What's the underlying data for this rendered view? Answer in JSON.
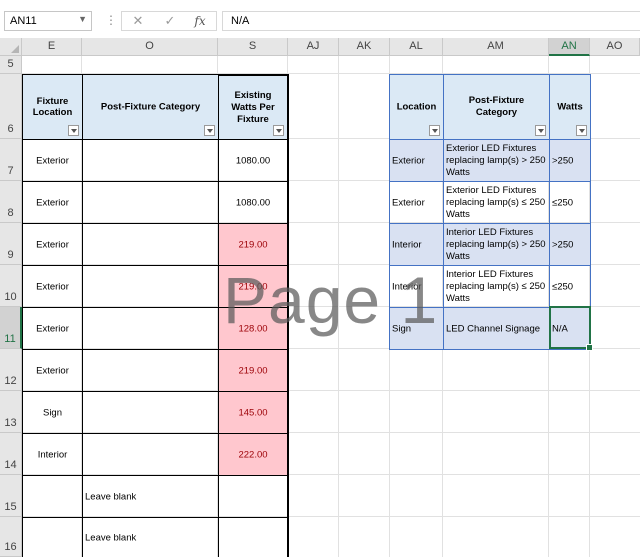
{
  "formula_bar": {
    "name_box": "AN11",
    "value": "N/A",
    "fx_label": "fx",
    "cancel_glyph": "✕",
    "enter_glyph": "✓"
  },
  "columns": [
    "E",
    "O",
    "S",
    "AJ",
    "AK",
    "AL",
    "AM",
    "AN",
    "AO"
  ],
  "rows": [
    "5",
    "6",
    "7",
    "8",
    "9",
    "10",
    "11",
    "12",
    "13",
    "14",
    "15",
    "16"
  ],
  "table1": {
    "headers": {
      "location": "Fixture Location",
      "category": "Post-Fixture Category",
      "watts": "Existing Watts Per Fixture"
    },
    "rows": [
      {
        "location": "Exterior",
        "category": "",
        "watts": "1080.00",
        "highlight": false
      },
      {
        "location": "Exterior",
        "category": "",
        "watts": "1080.00",
        "highlight": false
      },
      {
        "location": "Exterior",
        "category": "",
        "watts": "219.00",
        "highlight": true
      },
      {
        "location": "Exterior",
        "category": "",
        "watts": "219.00",
        "highlight": true
      },
      {
        "location": "Exterior",
        "category": "",
        "watts": "128.00",
        "highlight": true
      },
      {
        "location": "Exterior",
        "category": "",
        "watts": "219.00",
        "highlight": true
      },
      {
        "location": "Sign",
        "category": "",
        "watts": "145.00",
        "highlight": true
      },
      {
        "location": "Interior",
        "category": "",
        "watts": "222.00",
        "highlight": true
      },
      {
        "location": "",
        "category": "Leave blank",
        "watts": "",
        "highlight": false
      },
      {
        "location": "",
        "category": "Leave blank",
        "watts": "",
        "highlight": false
      }
    ]
  },
  "table2": {
    "headers": {
      "location": "Location",
      "category": "Post-Fixture Category",
      "watts": "Watts"
    },
    "rows": [
      {
        "location": "Exterior",
        "category": "Exterior LED Fixtures replacing lamp(s) > 250 Watts",
        "watts": ">250"
      },
      {
        "location": "Exterior",
        "category": "Exterior LED Fixtures replacing lamp(s) ≤ 250 Watts",
        "watts": "≤250"
      },
      {
        "location": "Interior",
        "category": "Interior LED Fixtures replacing lamp(s) > 250 Watts",
        "watts": ">250"
      },
      {
        "location": "Interior",
        "category": "Interior LED Fixtures replacing lamp(s) ≤ 250 Watts",
        "watts": "≤250"
      },
      {
        "location": "Sign",
        "category": "LED Channel Signage",
        "watts": "N/A"
      }
    ]
  },
  "watermark": "Page 1",
  "colors": {
    "header_fill": "#dbe9f5",
    "bad_fill": "#ffc7ce",
    "bad_text": "#9c0006",
    "band_fill": "#d9e1f2",
    "table_border": "#4472c4",
    "selection": "#217346"
  }
}
